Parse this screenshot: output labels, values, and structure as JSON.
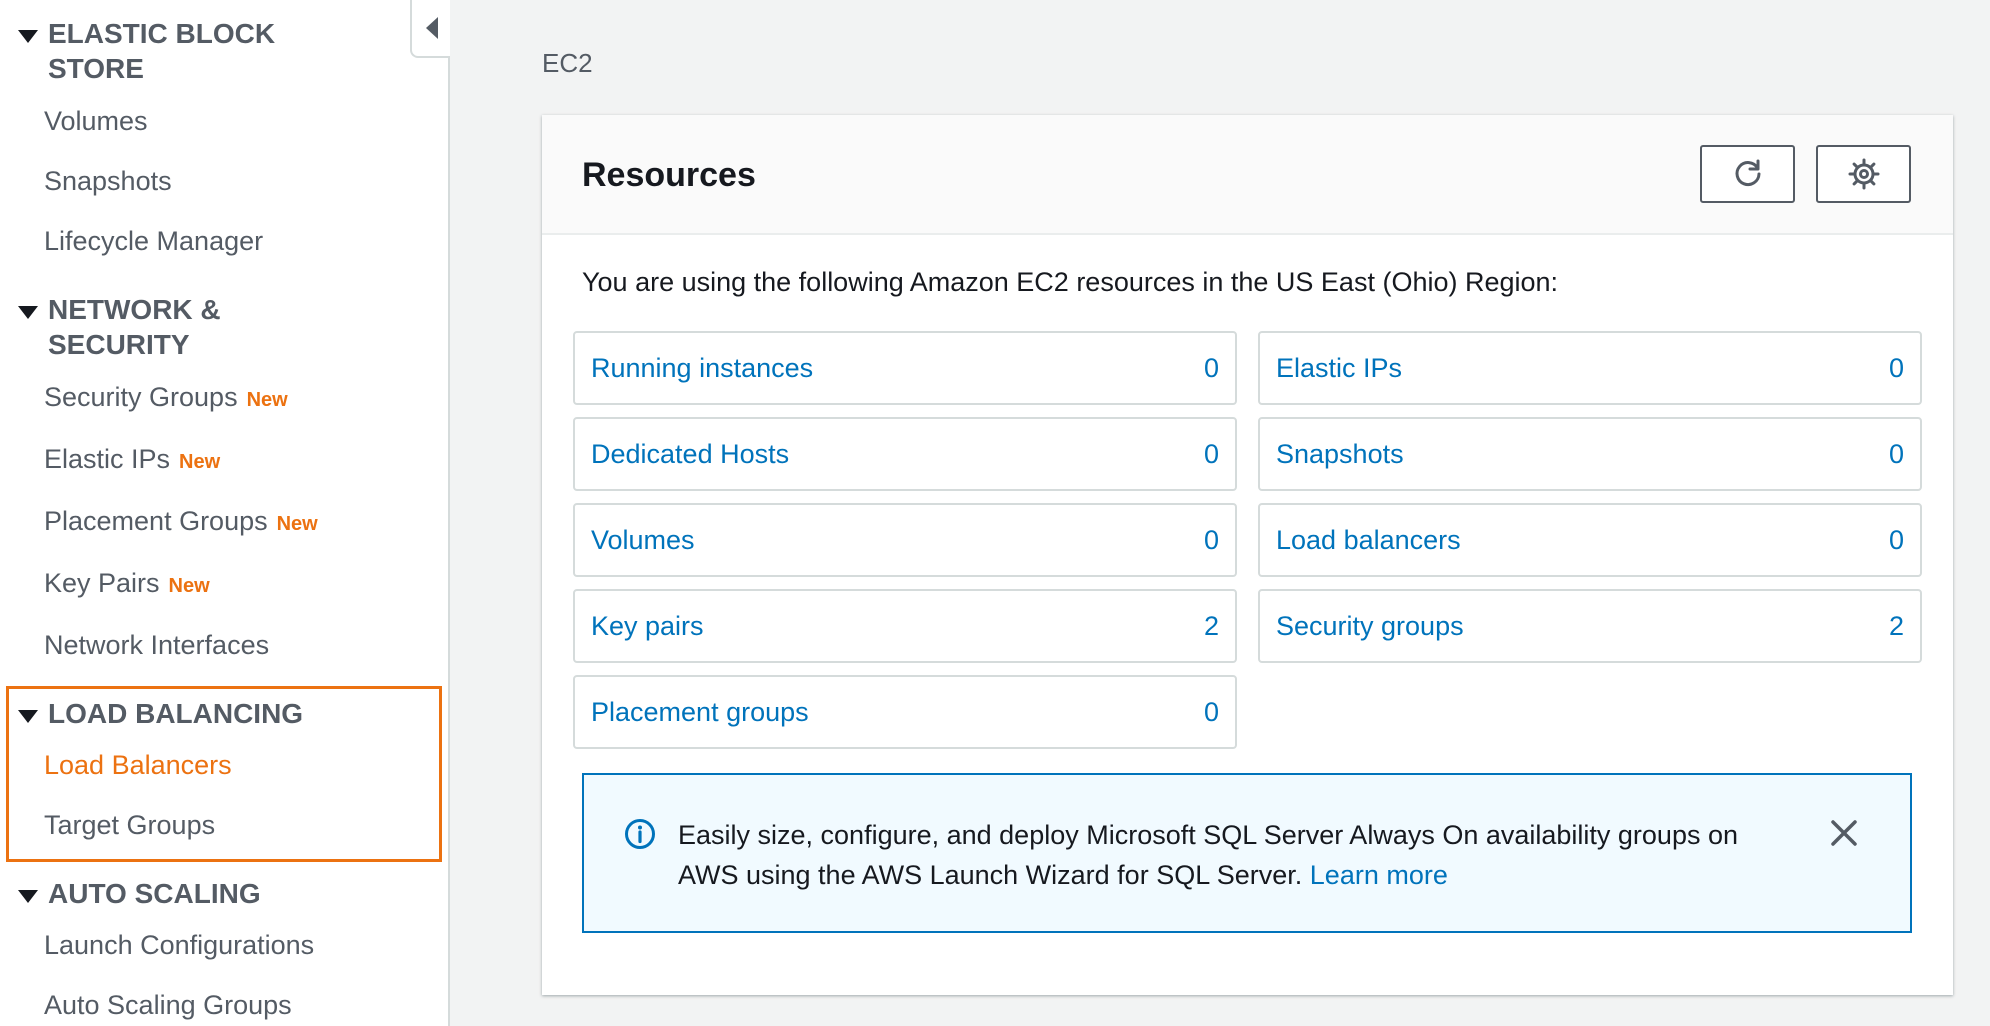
{
  "sidebar": {
    "sections": [
      {
        "title": "ELASTIC BLOCK STORE",
        "items": [
          "Volumes",
          "Snapshots",
          "Lifecycle Manager"
        ]
      },
      {
        "title": "NETWORK & SECURITY",
        "items": [
          "Security Groups",
          "Elastic IPs",
          "Placement Groups",
          "Key Pairs",
          "Network Interfaces"
        ]
      },
      {
        "title": "LOAD BALANCING",
        "items": [
          "Load Balancers",
          "Target Groups"
        ]
      },
      {
        "title": "AUTO SCALING",
        "items": [
          "Launch Configurations",
          "Auto Scaling Groups"
        ]
      }
    ],
    "new_badge": "New",
    "active_item": "Load Balancers"
  },
  "breadcrumb": "EC2",
  "resources": {
    "title": "Resources",
    "intro": "You are using the following Amazon EC2 resources in the US East (Ohio) Region:",
    "left": [
      {
        "label": "Running instances",
        "count": "0"
      },
      {
        "label": "Dedicated Hosts",
        "count": "0"
      },
      {
        "label": "Volumes",
        "count": "0"
      },
      {
        "label": "Key pairs",
        "count": "2"
      },
      {
        "label": "Placement groups",
        "count": "0"
      }
    ],
    "right": [
      {
        "label": "Elastic IPs",
        "count": "0"
      },
      {
        "label": "Snapshots",
        "count": "0"
      },
      {
        "label": "Load balancers",
        "count": "0"
      },
      {
        "label": "Security groups",
        "count": "2"
      }
    ]
  },
  "info": {
    "text": "Easily size, configure, and deploy Microsoft SQL Server Always On availability groups on AWS using the AWS Launch Wizard for SQL Server.",
    "link": "Learn more"
  },
  "colors": {
    "accent": "#ec7211",
    "link": "#0073bb",
    "info_bg": "#f1faff"
  }
}
